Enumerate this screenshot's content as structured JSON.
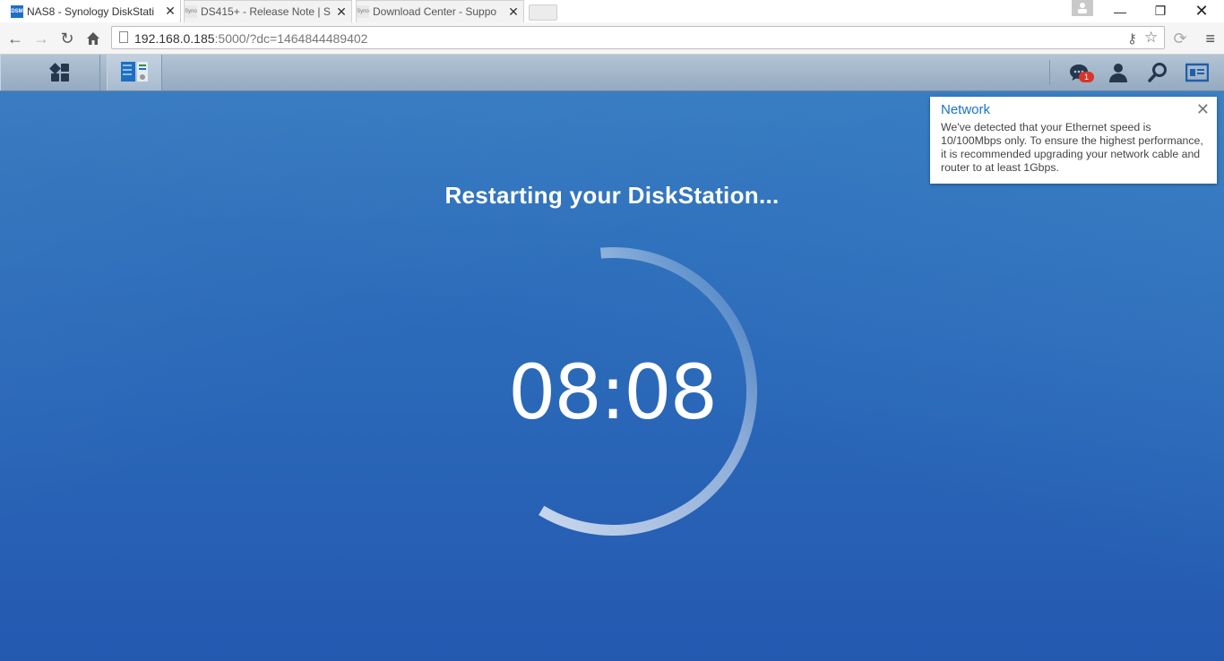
{
  "browser": {
    "tabs": [
      {
        "title": "NAS8 - Synology DiskStati",
        "favicon": "DSM",
        "active": true
      },
      {
        "title": "DS415+ - Release Note | S",
        "favicon": "Syno",
        "active": false
      },
      {
        "title": "Download Center - Suppo",
        "favicon": "Syno",
        "active": false
      }
    ],
    "url_host": "192.168.0.185",
    "url_rest": ":5000/?dc=1464844489402"
  },
  "dsm": {
    "taskbar": {
      "notification_count": "1"
    },
    "restart": {
      "title": "Restarting your DiskStation...",
      "countdown": "08:08",
      "progress_fraction": 0.6
    },
    "notification": {
      "title": "Network",
      "body": "We've detected that your Ethernet speed is 10/100Mbps only. To ensure the highest performance, it is recommended upgrading your network cable and router to at least 1Gbps."
    }
  },
  "colors": {
    "desktop_blue": "#2b66b8",
    "accent_link": "#1a73c8",
    "badge_red": "#d9342b"
  }
}
